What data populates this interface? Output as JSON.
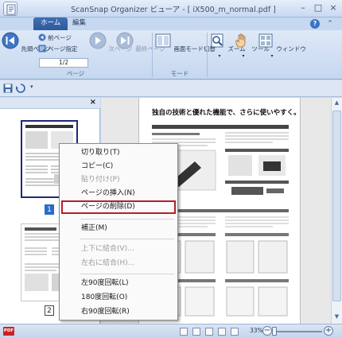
{
  "window": {
    "title": "ScanSnap Organizer ビューア - [ iX500_m_normal.pdf ]",
    "minimize": "–",
    "maximize": "□",
    "close": "×"
  },
  "ribbon": {
    "tabs": [
      {
        "label": "ホーム",
        "active": true
      },
      {
        "label": "編集",
        "active": false
      }
    ],
    "help": "?",
    "page_group": {
      "label": "ページ",
      "first_page": "先頭ページ",
      "prev_page": "前ページ",
      "goto_page": "ページ指定",
      "page_indicator": "1/2",
      "next_page": "次ページ",
      "last_page": "最終ページ"
    },
    "mode_group": {
      "label": "モード",
      "image_mode": "画面モード切替"
    },
    "zoom": "ズーム",
    "tools": "ツール",
    "window": "ウィンドウ"
  },
  "thumbnails": {
    "close": "×",
    "pages": [
      {
        "number": "1",
        "selected": true
      },
      {
        "number": "2",
        "selected": false
      }
    ]
  },
  "document": {
    "heading": "独自の技術と優れた機能で、さらに使いやすく。"
  },
  "context_menu": {
    "items": [
      {
        "label": "切り取り(T)",
        "disabled": false
      },
      {
        "label": "コピー(C)",
        "disabled": false
      },
      {
        "label": "貼り付け(P)",
        "disabled": true
      },
      {
        "label": "ページの挿入(N)",
        "disabled": false
      },
      {
        "label": "ページの削除(D)",
        "disabled": false,
        "highlighted": true
      },
      {
        "label": "補正(M)",
        "disabled": false
      },
      {
        "label": "上下に結合(V)...",
        "disabled": true
      },
      {
        "label": "左右に結合(H)...",
        "disabled": true
      },
      {
        "label": "左90度回転(L)",
        "disabled": false
      },
      {
        "label": "180度回転(O)",
        "disabled": false
      },
      {
        "label": "右90度回転(R)",
        "disabled": false
      }
    ]
  },
  "statusbar": {
    "pdf_badge": "PDF",
    "zoom_level": "33%",
    "zoom_level_fraction": 0.33,
    "zoom_minus": "−",
    "zoom_plus": "+"
  },
  "colors": {
    "accent": "#2e5a9c",
    "highlight_border": "#b2202c",
    "selected_page_number": "#2a6cc9"
  }
}
